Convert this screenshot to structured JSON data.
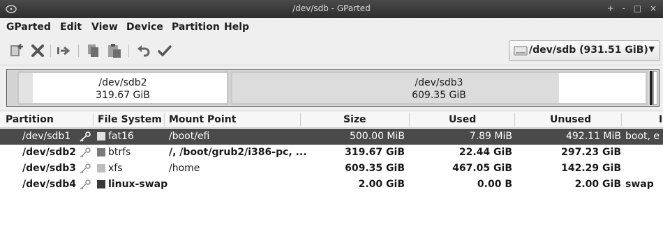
{
  "window": {
    "title": "/dev/sdb - GParted",
    "controls": [
      "+",
      "-",
      "□",
      "×"
    ]
  },
  "menu": [
    "GParted",
    "Edit",
    "View",
    "Device",
    "Partition",
    "Help"
  ],
  "toolbar": {
    "icons": [
      "new-partition-icon",
      "delete-icon",
      "resize-move-icon",
      "copy-icon",
      "paste-icon",
      "undo-icon",
      "apply-icon"
    ],
    "device_selector": "/dev/sdb (931.51 GiB)"
  },
  "diskmap": {
    "sdb2": {
      "name": "/dev/sdb2",
      "size": "319.67 GiB"
    },
    "sdb3": {
      "name": "/dev/sdb3",
      "size": "609.35 GiB"
    }
  },
  "table": {
    "headers": [
      "Partition",
      "File System",
      "Mount Point",
      "Size",
      "Used",
      "Unused",
      "I"
    ],
    "rows": [
      {
        "partition": "/dev/sdb1",
        "fs": "fat16",
        "fs_color": "#e0e0e0",
        "mount": "/boot/efi",
        "size": "500.00 MiB",
        "used": "7.89 MiB",
        "unused": "492.11 MiB",
        "flags": "boot, e",
        "selected": true
      },
      {
        "partition": "/dev/sdb2",
        "fs": "btrfs",
        "fs_color": "#7a7a7a",
        "mount": "/, /boot/grub2/i386-pc, ...",
        "size": "319.67 GiB",
        "used": "22.44 GiB",
        "unused": "297.23 GiB",
        "flags": "",
        "selected": false
      },
      {
        "partition": "/dev/sdb3",
        "fs": "xfs",
        "fs_color": "#bdbdbd",
        "mount": "/home",
        "size": "609.35 GiB",
        "used": "467.05 GiB",
        "unused": "142.29 GiB",
        "flags": "",
        "selected": false
      },
      {
        "partition": "/dev/sdb4",
        "fs": "linux-swap",
        "fs_color": "#3a3a3a",
        "mount": "",
        "size": "2.00 GiB",
        "used": "0.00 B",
        "unused": "2.00 GiB",
        "flags": "swap",
        "selected": false
      }
    ]
  }
}
